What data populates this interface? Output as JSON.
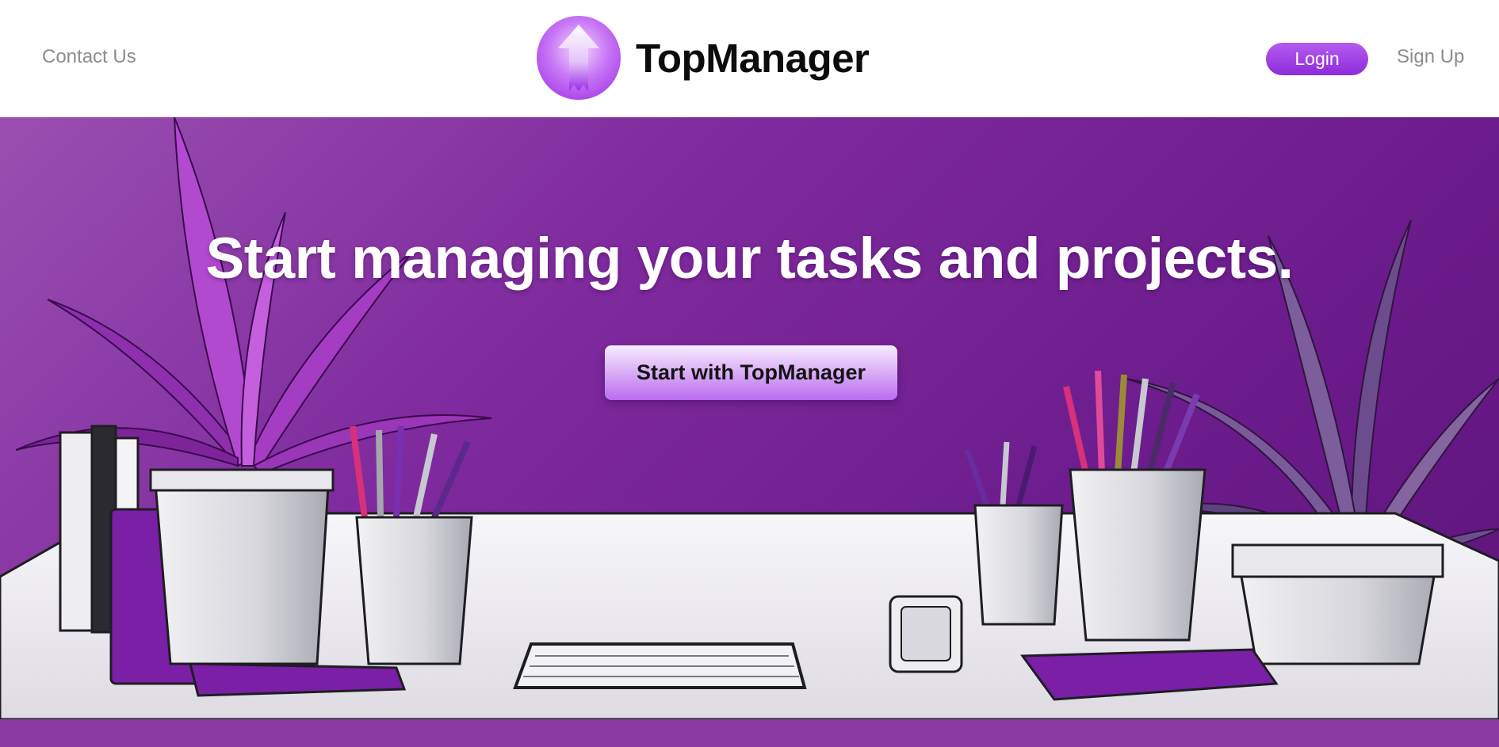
{
  "header": {
    "contact_label": "Contact Us",
    "brand_name": "TopManager",
    "login_label": "Login",
    "signup_label": "Sign Up"
  },
  "hero": {
    "headline": "Start managing your tasks and projects.",
    "cta_label": "Start with TopManager"
  },
  "icons": {
    "logo": "upload-arrow-icon"
  },
  "colors": {
    "accent": "#9b28e4",
    "hero_background": "#7f2a9e",
    "link_gray": "#8d8d8d",
    "text_dark": "#0c0c0c"
  }
}
